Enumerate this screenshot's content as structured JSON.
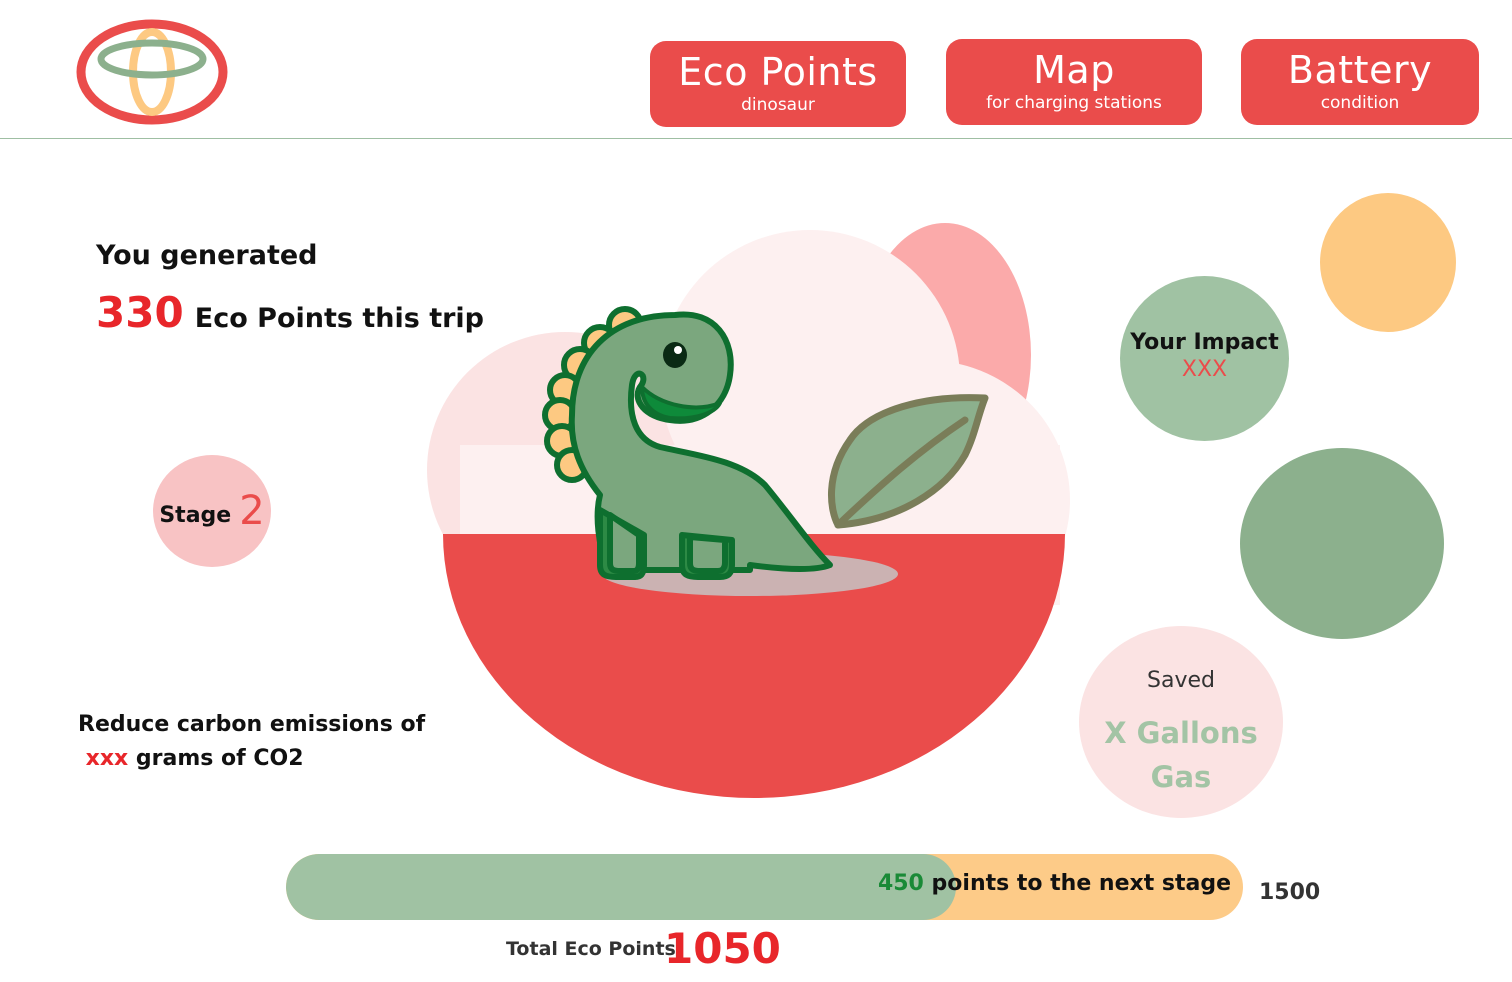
{
  "header": {
    "nav": [
      {
        "title": "Eco Points",
        "subtitle": "dinosaur"
      },
      {
        "title": "Map",
        "subtitle": "for charging stations"
      },
      {
        "title": "Battery",
        "subtitle": "condition"
      }
    ]
  },
  "trip": {
    "label": "You generated",
    "points": "330",
    "suffix": "Eco Points this trip"
  },
  "stage": {
    "label": "Stage",
    "value": "2"
  },
  "reduce": {
    "line1": "Reduce carbon emissions of",
    "amount": "xxx",
    "line2_rest": " grams of CO2"
  },
  "impact": {
    "label": "Your Impact",
    "value": "XXX"
  },
  "saved": {
    "label": "Saved",
    "value_line1": "X Gallons",
    "value_line2": "Gas"
  },
  "progress": {
    "current": 1050,
    "max": 1500,
    "remaining": "450",
    "remaining_text": " points to the next stage",
    "max_label": "1500"
  },
  "total": {
    "label": "Total Eco Points",
    "value": "1050"
  },
  "colors": {
    "accent_red": "#ea4c4b",
    "sage_green": "#a0c2a3",
    "orange": "#fdc982",
    "dino_green": "#7ba77e",
    "dino_outline": "#0e6f2f"
  },
  "icons": {
    "logo": "ring-logo-icon",
    "dino": "dinosaur-illustration",
    "leaf": "leaf-icon"
  }
}
